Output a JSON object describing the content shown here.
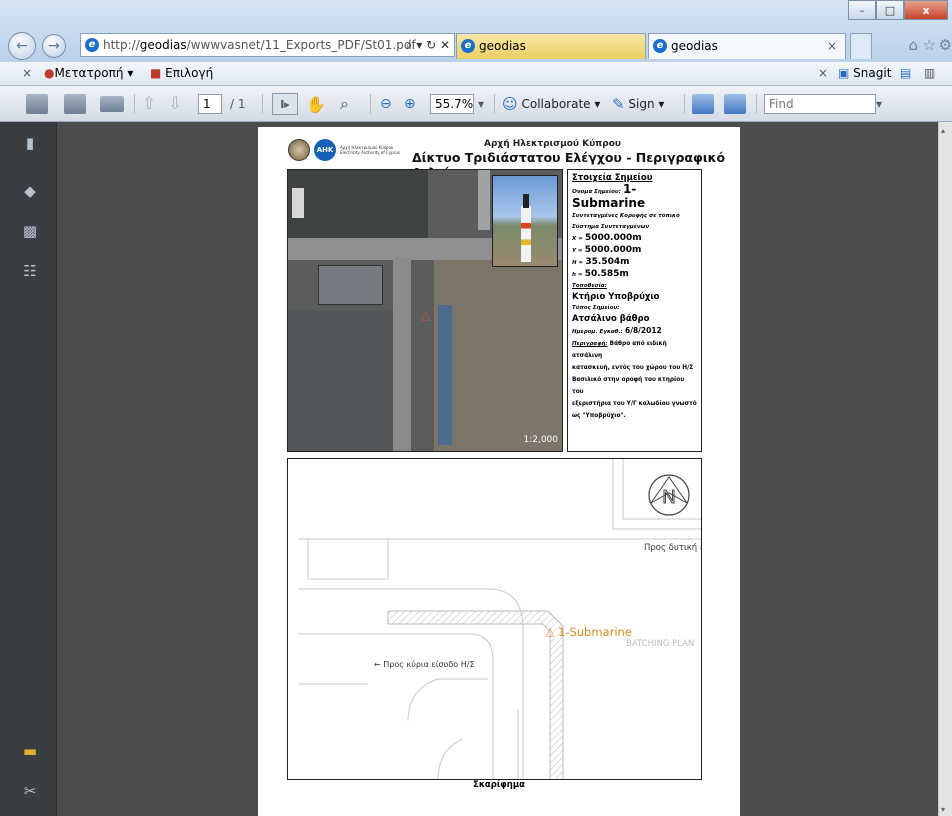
{
  "browser": {
    "url_prefix": "http://",
    "url_domain": "geodias",
    "url_path": "/wwwvasnet/11_Exports_PDF/St01.pdf",
    "addr_controls": "⌕ ▾ ↻ ✕",
    "tabs": [
      {
        "label": "geodias"
      },
      {
        "label": "geodias",
        "close": "×"
      }
    ],
    "window_buttons": [
      "–",
      "□",
      "x"
    ]
  },
  "favorites": {
    "close": "×",
    "convert_label": "Μετατροπή",
    "select_label": "Επιλογή",
    "snagit_close": "×",
    "snagit_label": "Snagit"
  },
  "pdf_toolbar": {
    "page_current": "1",
    "page_total": "/ 1",
    "zoom": "55.7%",
    "collaborate_label": "Collaborate",
    "sign_label": "Sign",
    "find_placeholder": "Find"
  },
  "document": {
    "logo_text": "Αρχή Ηλεκτρισμού Κύπρου Electricity Authority of Cyprus",
    "logo2_text": "AHK",
    "org_title": "Αρχή Ηλεκτρισμού Κύπρου",
    "doc_title": "Δίκτυο Τριδιάστατου Ελέγχου - Περιγραφικό Δελτίο",
    "scale_label": "1:2,000",
    "info": {
      "heading": "Στοιχεία Σημείου",
      "name_label": "Όνομα Σημείου:",
      "name_value": "1-Submarine",
      "coords_label": "Συντεταγμένες Κορυφής σε τοπικό",
      "system_label": "Σύστημα Συντεταγμένων",
      "x_label": "X =",
      "x_value": "5000.000m",
      "y_label": "Y =",
      "y_value": "5000.000m",
      "h_label": "H =",
      "h_value": "35.504m",
      "h2_label": "h =",
      "h2_value": "50.585m",
      "location_label": "Τοποθεσία:",
      "location_value": "Κτήριο Υποβρύχιο",
      "type_label": "Τύπος Σημείου:",
      "type_value": "Ατσάλινο βάθρο",
      "date_label": "Ημερομ. Εγκαθ.:",
      "date_value": "6/8/2012",
      "desc_label": "Περιγραφή:",
      "desc_lines": [
        "Βάθρο από ειδική ατσάλινη",
        "κατασκευή, εντός του χώρου του Η/Σ",
        "Βασιλικό στην οροφή του κτηρίου του",
        "εξεριστήρια του Υ/Γ καλωδίου γνωστό",
        "ως \"Υποβρύχιο\"."
      ]
    },
    "sketch": {
      "west_label": "Προς δυτική ε",
      "point_label": "1-Submarine",
      "batching_label": "BATCHING PLAN",
      "entrance_label": "← Προς κύρια είσοδο Η/Σ",
      "north_letter": "N",
      "caption": "Σκαρίφημα"
    }
  },
  "colors": {
    "accent_tab": "#eccf62",
    "point_orange": "#e08a1e",
    "viewer_bg": "#4c4c4c"
  }
}
